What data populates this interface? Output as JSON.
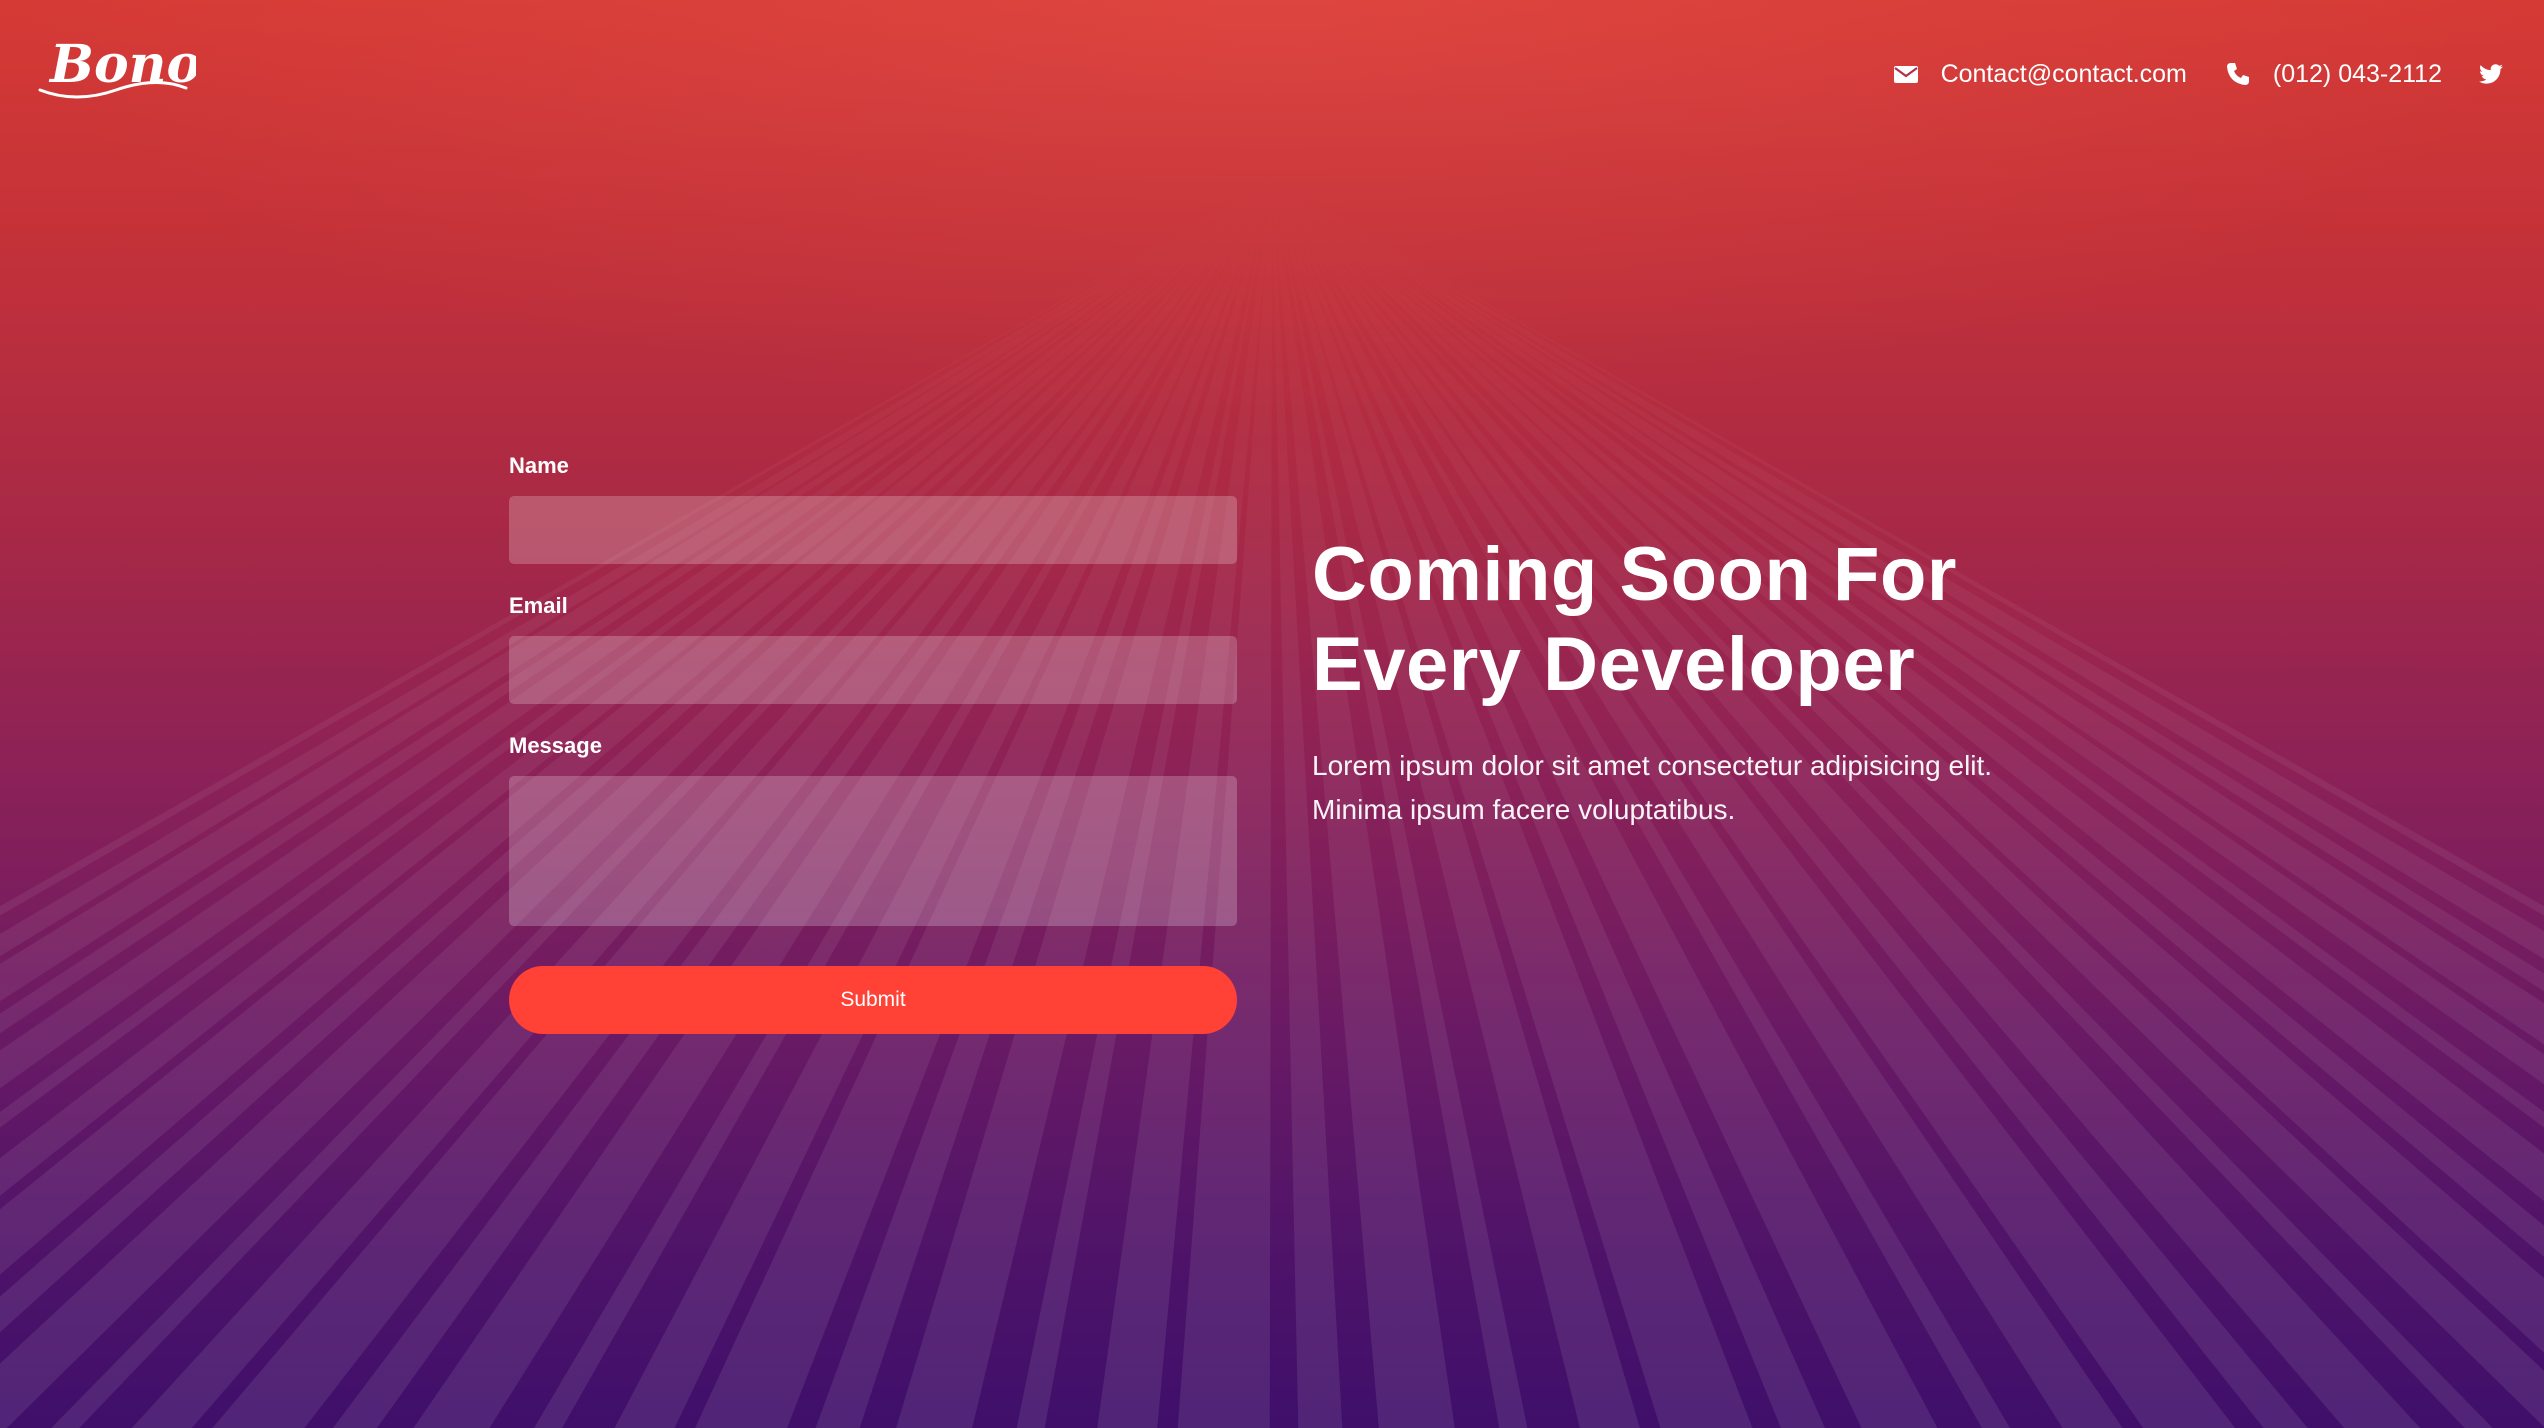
{
  "brand": {
    "logo_text": "Bono"
  },
  "header": {
    "email": "Contact@contact.com",
    "phone": "(012) 043-2112",
    "email_icon": "envelope-icon",
    "phone_icon": "phone-icon",
    "twitter_icon": "twitter-icon"
  },
  "form": {
    "name_label": "Name",
    "name_value": "",
    "email_label": "Email",
    "email_value": "",
    "message_label": "Message",
    "message_value": "",
    "submit_label": "Submit"
  },
  "hero": {
    "title": "Coming Soon For\nEvery Developer",
    "text": "Lorem ipsum dolor sit amet consectetur adipisicing elit.\nMinima ipsum facere voluptatibus."
  },
  "colors": {
    "gradient_top": "#d63a35",
    "gradient_bottom": "#3f0f6a",
    "accent": "#ff4136",
    "text": "#ffffff"
  }
}
